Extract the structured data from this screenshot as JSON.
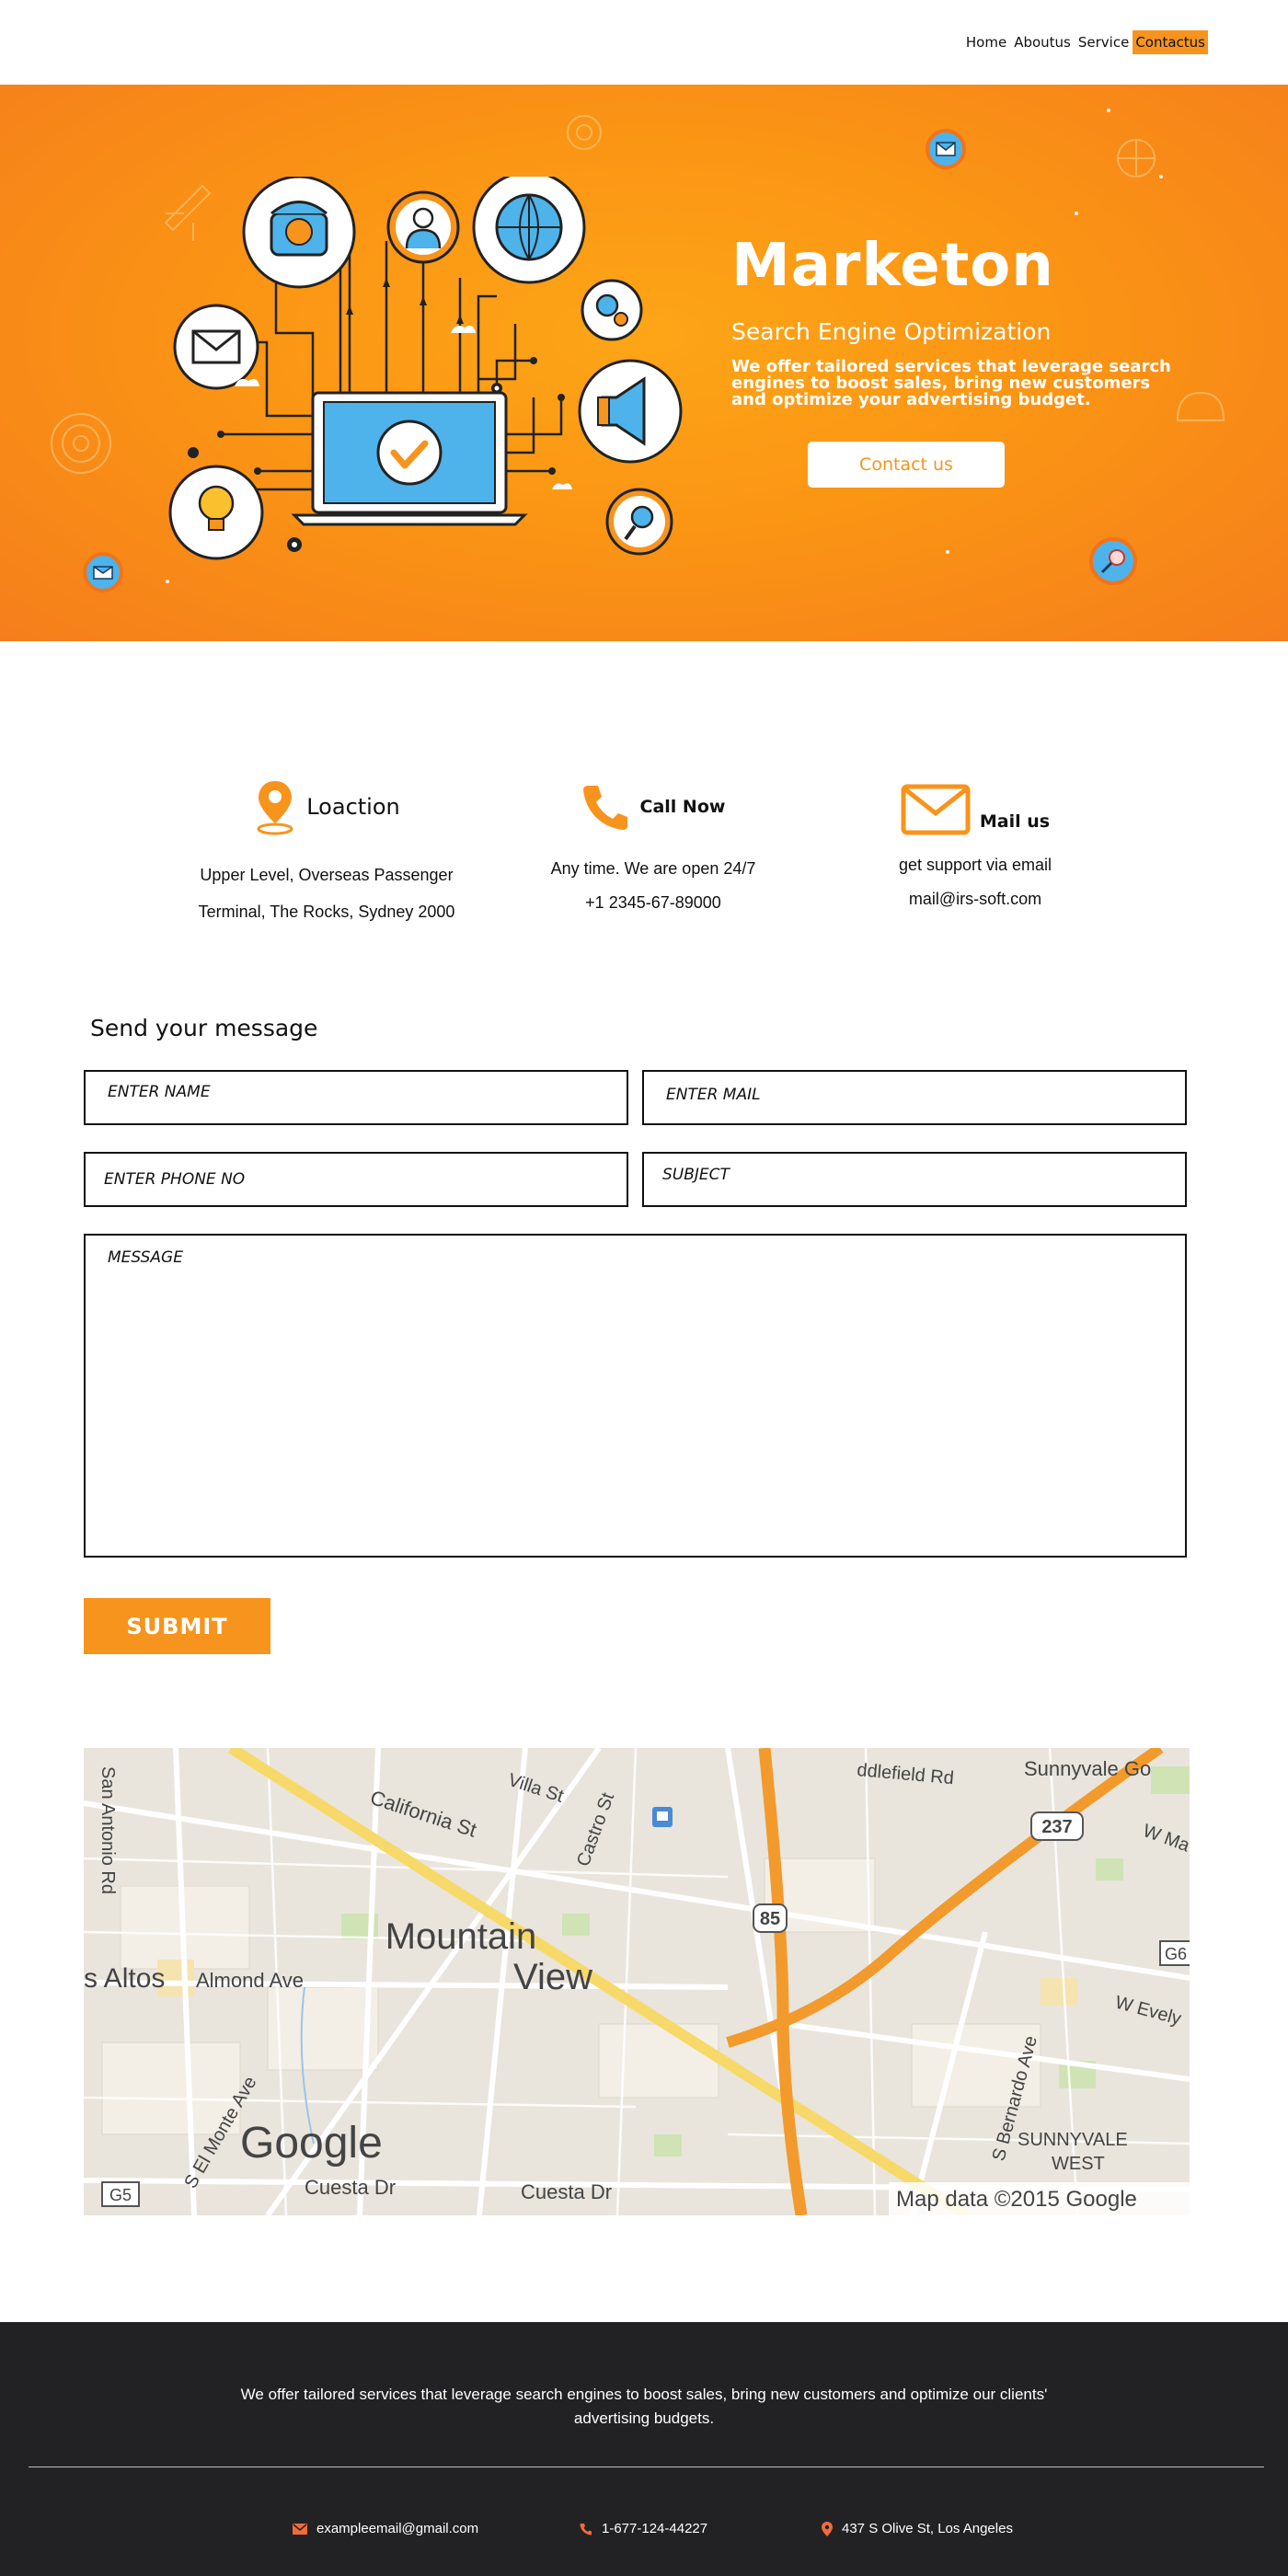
{
  "nav": {
    "links": [
      "Home",
      "Aboutus",
      "Service",
      "Contactus"
    ],
    "active": "Contactus"
  },
  "hero": {
    "title": "Marketon",
    "subtitle": "Search Engine Optimization",
    "description": "We offer tailored services that leverage search engines to boost sales, bring new customers and optimize your advertising budget.",
    "button_label": "Contact us"
  },
  "contact_info": [
    {
      "icon": "location-pin-icon",
      "title": "Loaction",
      "lines": [
        "Upper Level, Overseas Passenger",
        "Terminal, The Rocks, Sydney 2000"
      ]
    },
    {
      "icon": "phone-icon",
      "title": "Call Now",
      "lines": [
        "Any time. We are open 24/7",
        "+1 2345-67-89000"
      ]
    },
    {
      "icon": "envelope-icon",
      "title": "Mail us",
      "lines": [
        "get support via email",
        "mail@irs-soft.com"
      ]
    }
  ],
  "form": {
    "heading": "Send your message",
    "name_placeholder": "ENTER NAME",
    "mail_placeholder": "ENTER MAIL",
    "phone_placeholder": "ENTER PHONE NO",
    "subject_placeholder": "SUBJECT",
    "message_placeholder": "MESSAGE",
    "submit_label": "SUBMIT"
  },
  "map": {
    "labels": {
      "city": "Mountain",
      "city2": "View",
      "los_altos": "s Altos",
      "almond": "Almond Ave",
      "california": "California St",
      "castro": "Castro St",
      "villa": "Villa St",
      "san_antonio": "San Antonio Rd",
      "el_monte": "S El Monte Ave",
      "cuesta1": "Cuesta Dr",
      "cuesta2": "Cuesta Dr",
      "bernardo": "S Bernardo Ave",
      "sunnyvale_west1": "SUNNYVALE",
      "sunnyvale_west2": "WEST",
      "sunnyvale_go": "Sunnyvale Go",
      "evelyn": "W Evely",
      "w_ma": "W Ma",
      "middlefield": "ddlefield Rd",
      "route85": "85",
      "route237": "237",
      "g5": "G5",
      "g6": "G6",
      "google": "Google",
      "attribution": "Map data ©2015 Google"
    }
  },
  "footer": {
    "description": "We offer tailored services that leverage search engines to boost sales, bring new customers and optimize our clients' advertising budgets.",
    "email": "exampleemail@gmail.com",
    "phone": "1-677-124-44227",
    "address": "437 S Olive St, Los Angeles"
  },
  "colors": {
    "accent": "#f7941d",
    "footer_bg": "#222224",
    "illustration_blue": "#4db3ea"
  }
}
